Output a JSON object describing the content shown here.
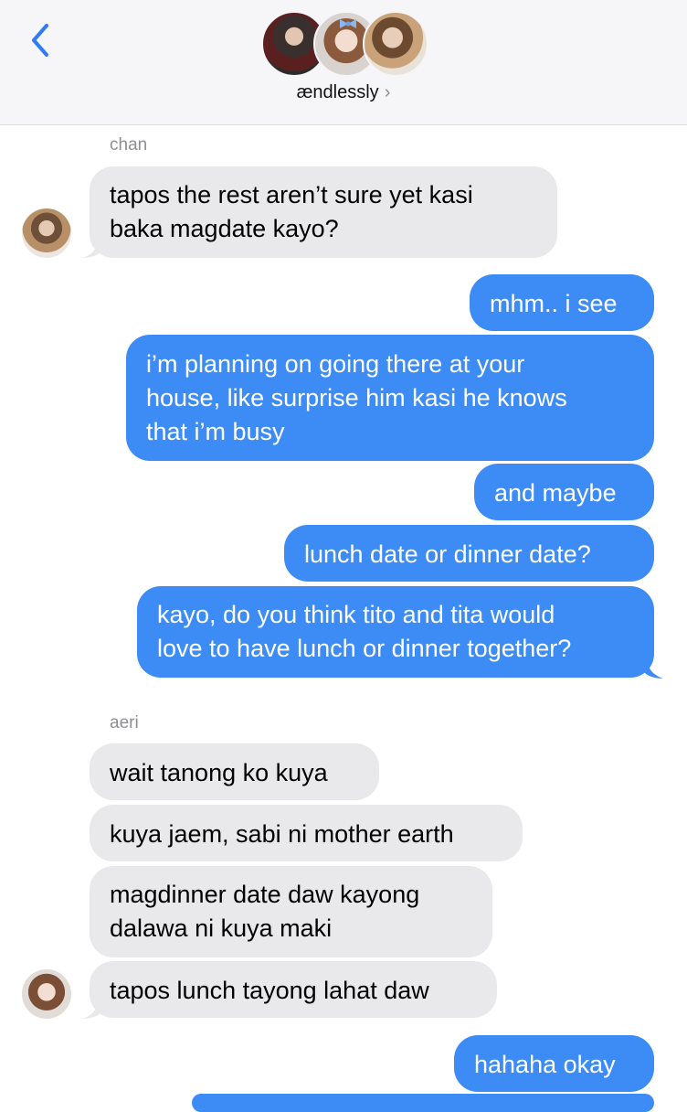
{
  "header": {
    "group_name": "ændlessly",
    "chevron": "›",
    "back_icon": "chevron-left-icon",
    "accent_color": "#2f7cf6"
  },
  "messages": [
    {
      "type": "sender",
      "text": "chan"
    },
    {
      "type": "in",
      "text": "tapos the rest aren’t sure yet kasi\nbaka magdate kayo?"
    },
    {
      "type": "out",
      "text": "mhm.. i see"
    },
    {
      "type": "out",
      "text": "i’m planning on going there at your\nhouse, like surprise him kasi he knows\nthat i’m busy"
    },
    {
      "type": "out",
      "text": "and maybe"
    },
    {
      "type": "out",
      "text": "lunch date or dinner date?"
    },
    {
      "type": "out",
      "text": "kayo, do you think tito and tita would\nlove to have lunch or dinner together?"
    },
    {
      "type": "sender",
      "text": "aeri"
    },
    {
      "type": "in",
      "text": "wait tanong ko kuya"
    },
    {
      "type": "in",
      "text": "kuya jaem, sabi ni mother earth"
    },
    {
      "type": "in",
      "text": "magdinner date daw kayong\ndalawa ni kuya maki"
    },
    {
      "type": "in",
      "text": "tapos lunch tayong lahat daw"
    },
    {
      "type": "out",
      "text": "hahaha okay"
    }
  ],
  "colors": {
    "incoming_bubble": "#e9e9eb",
    "outgoing_bubble": "#3d8cf5",
    "sender_label": "#8e8e93"
  }
}
